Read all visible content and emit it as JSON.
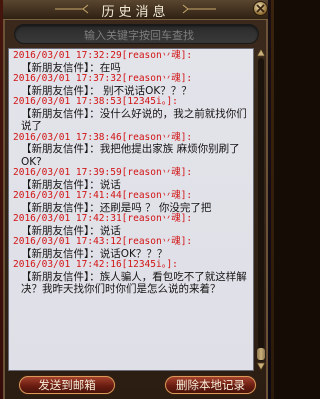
{
  "window": {
    "title": "历史消息"
  },
  "search": {
    "placeholder": "输入关键字按回车查找"
  },
  "messages": [
    {
      "header": "2016/03/01 17:32:29[reason丷魂]:",
      "body": "【新朋友信件】：在吗"
    },
    {
      "header": "2016/03/01 17:37:32[reason丷魂]:",
      "body": "【新朋友信件】：  别不说话OK？？？"
    },
    {
      "header": "2016/03/01 17:38:53[12345i。]:",
      "body": "【新朋友信件】：没什么好说的，我之前就找你们说了"
    },
    {
      "header": "2016/03/01 17:38:46[reason丷魂]:",
      "body": "【新朋友信件】：我把他提出家族  麻烦你别刷了OK?"
    },
    {
      "header": "2016/03/01 17:39:59[reason丷魂]:",
      "body": "【新朋友信件】：说话"
    },
    {
      "header": "2016/03/01 17:41:44[reason丷魂]:",
      "body": "【新朋友信件】：还刷是吗 ？  你没完了把"
    },
    {
      "header": "2016/03/01 17:42:31[reason丷魂]:",
      "body": "【新朋友信件】：说话"
    },
    {
      "header": "2016/03/01 17:43:12[reason丷魂]:",
      "body": "【新朋友信件】：说话OK？？？"
    },
    {
      "header": "2016/03/01 17:42:16[12345i。]:",
      "body": "【新朋友信件】：族人骗人，看包吃不了就这样解决？我昨天找你们时你们是怎么说的来着？"
    }
  ],
  "buttons": {
    "send_to_mailbox": "发送到邮箱",
    "delete_local": "删除本地记录"
  },
  "colors": {
    "header_red": "#d21414",
    "chat_bg": "#e3e3ea",
    "button_red": "#6a1d12"
  },
  "icons": {
    "close": "close-icon",
    "scroll_up": "scroll-up-arrow-icon",
    "scroll_down": "scroll-down-arrow-icon"
  },
  "scroll": {
    "position_fraction": 1.0
  }
}
